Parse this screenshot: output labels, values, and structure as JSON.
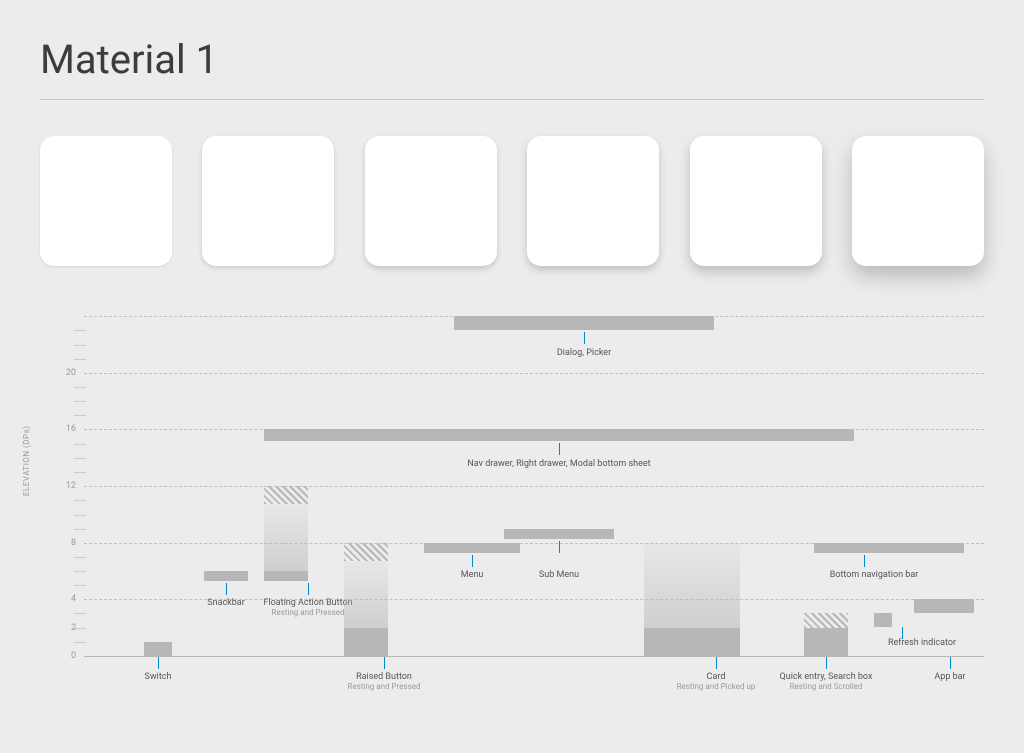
{
  "title": "Material 1",
  "axis_title": "ELEVATION (DPs)",
  "ylabels": {
    "y0": "0",
    "y2": "2",
    "y4": "4",
    "y8": "8",
    "y12": "12",
    "y16": "16",
    "y20": "20"
  },
  "labels": {
    "dialog": "Dialog, Picker",
    "navdrawer": "Nav drawer, Right drawer, Modal bottom sheet",
    "menu": "Menu",
    "submenu": "Sub Menu",
    "bottomnav": "Bottom navigation bar",
    "snackbar": "Snackbar",
    "fab": "Floating Action Button",
    "fab_sub": "Resting and Pressed",
    "raised": "Raised Button",
    "raised_sub": "Resting and Pressed",
    "card": "Card",
    "card_sub": "Resting and Picked up",
    "quick": "Quick entry, Search box",
    "quick_sub": "Resting and Scrolled",
    "refresh": "Refresh indicator",
    "appbar": "App bar",
    "switch": "Switch"
  },
  "chart_data": {
    "type": "bar",
    "ylabel": "ELEVATION (DPs)",
    "ylim": [
      0,
      24
    ],
    "ticks_major": [
      0,
      4,
      8,
      12,
      16,
      20,
      24
    ],
    "components": [
      {
        "name": "Switch",
        "resting": 1,
        "pressed": null,
        "notes": ""
      },
      {
        "name": "Snackbar",
        "resting": 6,
        "pressed": null,
        "notes": ""
      },
      {
        "name": "Floating Action Button",
        "resting": 6,
        "pressed": 12,
        "notes": "Resting and Pressed"
      },
      {
        "name": "Raised Button",
        "resting": 2,
        "pressed": 8,
        "notes": "Resting and Pressed"
      },
      {
        "name": "Menu",
        "resting": 8,
        "pressed": null,
        "notes": ""
      },
      {
        "name": "Sub Menu",
        "resting": 9,
        "pressed": null,
        "notes": ""
      },
      {
        "name": "Nav / Right drawer / Modal bottom sheet",
        "resting": 16,
        "pressed": null,
        "notes": ""
      },
      {
        "name": "Bottom navigation bar",
        "resting": 8,
        "pressed": null,
        "notes": ""
      },
      {
        "name": "Card",
        "resting": 2,
        "pressed": 8,
        "notes": "Resting and Picked up"
      },
      {
        "name": "Quick entry, Search box",
        "resting": 2,
        "pressed": 3,
        "notes": "Resting and Scrolled"
      },
      {
        "name": "Refresh indicator",
        "resting": 3,
        "pressed": null,
        "notes": ""
      },
      {
        "name": "App bar",
        "resting": 4,
        "pressed": null,
        "notes": ""
      },
      {
        "name": "Dialog, Picker",
        "resting": 24,
        "pressed": null,
        "notes": ""
      }
    ]
  }
}
